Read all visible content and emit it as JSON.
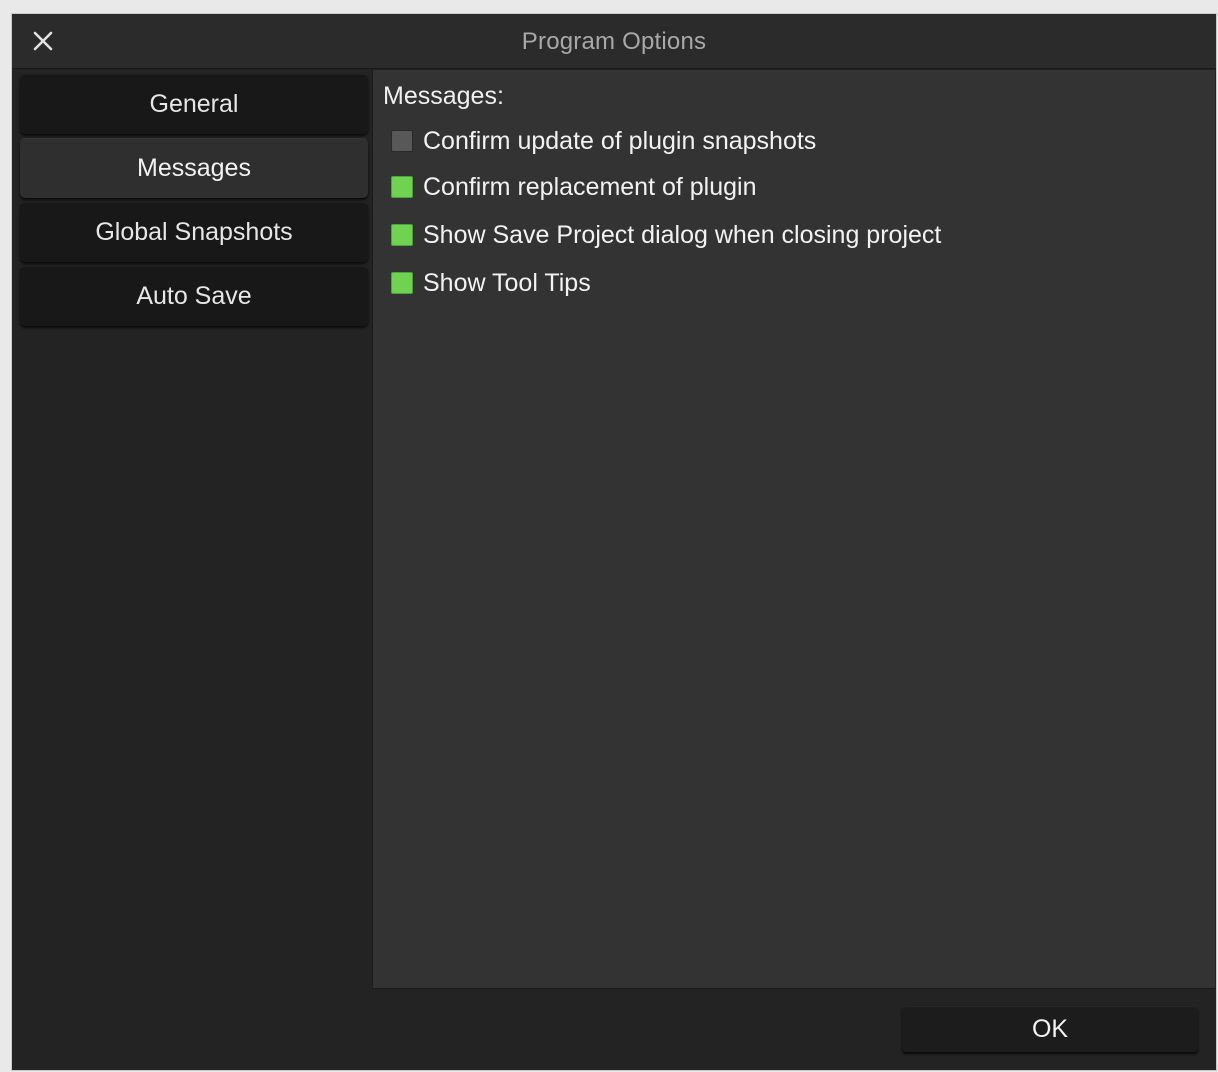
{
  "window": {
    "title": "Program Options"
  },
  "sidebar": {
    "items": [
      {
        "label": "General",
        "active": false
      },
      {
        "label": "Messages",
        "active": true
      },
      {
        "label": "Global Snapshots",
        "active": false
      },
      {
        "label": "Auto Save",
        "active": false
      }
    ]
  },
  "messages": {
    "heading": "Messages:",
    "options": [
      {
        "label": "Confirm update of plugin snapshots",
        "checked": false
      },
      {
        "label": "Confirm replacement of plugin",
        "checked": true
      },
      {
        "label": "Show Save Project dialog when closing project",
        "checked": true
      },
      {
        "label": "Show Tool Tips",
        "checked": true
      }
    ]
  },
  "footer": {
    "ok_label": "OK"
  },
  "colors": {
    "checked": "#6fd34f",
    "unchecked": "#585858",
    "background": "#232323",
    "panel": "#333333"
  },
  "icons": {
    "close": "close-icon"
  }
}
